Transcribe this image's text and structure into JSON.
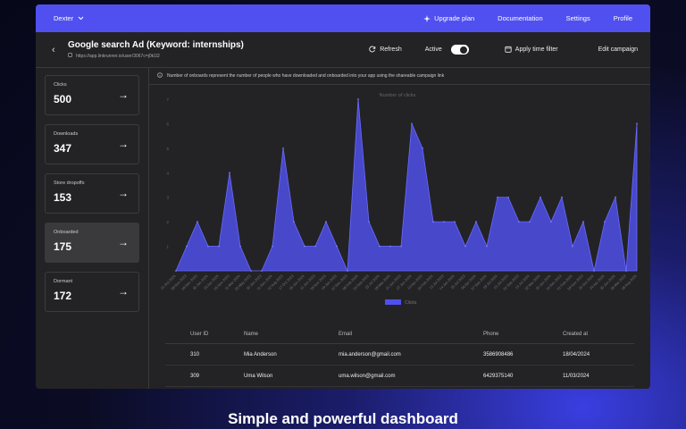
{
  "topbar": {
    "user": "Dexter",
    "nav": [
      {
        "label": "Upgrade plan",
        "icon": "sparkle-icon"
      },
      {
        "label": "Documentation"
      },
      {
        "label": "Settings"
      },
      {
        "label": "Profile"
      }
    ]
  },
  "header": {
    "title": "Google search Ad (Keyword: internships)",
    "url": "https://app.linkrunner.io/user/3067c=j0k1l2",
    "refresh": "Refresh",
    "active": "Active",
    "time_filter": "Apply time filter",
    "edit": "Edit campaign"
  },
  "sidebar": {
    "cards": [
      {
        "label": "Clicks",
        "value": "500"
      },
      {
        "label": "Downloads",
        "value": "347"
      },
      {
        "label": "Store dropoffs",
        "value": "153"
      },
      {
        "label": "Onboarded",
        "value": "175",
        "active": true
      },
      {
        "label": "Dormant",
        "value": "172"
      }
    ]
  },
  "notice": "Number of onboards represent the number of people who have downloaded and onboarded into your app using the shareable campaign link",
  "chart_data": {
    "type": "area",
    "title": "Number of clicks",
    "legend": "Clicks",
    "color": "#5050f0",
    "ylim": [
      0,
      7
    ],
    "yticks": [
      "1",
      "2",
      "3",
      "4",
      "5",
      "6",
      "7"
    ],
    "x": [
      "21 Oct 2024",
      "28 Nov 2023",
      "09 Dec 2023",
      "30 Jan 2024",
      "05 Apr 2024",
      "15 Nov 2023",
      "11 Mar 2024",
      "25 May 2023",
      "30 Jan 2023",
      "11 Dec 2024",
      "12 Aug 2023",
      "17 Oct 2023",
      "05 Jun 2024",
      "11 Jun 2023",
      "29 Nov 2023",
      "19 Jan 2023",
      "07 Dec 2023",
      "06 Feb 2024",
      "23 Sep 2023",
      "22 Jul 2024",
      "09 Mar 2024",
      "21 Jun 2023",
      "27 Jun 2024",
      "14 Apr 2023",
      "24 Feb 2024",
      "12 Jul 2023",
      "14 Jan 2024",
      "20 Jul 2023",
      "06 Apr 2024",
      "27 Sep 2024",
      "18 Jul 2024",
      "01 Jul 2023",
      "01 Sep 2023",
      "13 Jul 2024",
      "22 Mar 2024",
      "20 Jun 2024",
      "14 Dec 2023",
      "01 Feb 2024",
      "09 Nov 2023",
      "20 Oct 2024",
      "24 Apr 2024",
      "30 Jun 2024",
      "26 Mar 2023",
      "18 Aug 2024"
    ],
    "values": [
      0,
      1,
      2,
      1,
      1,
      4,
      1,
      0,
      0,
      1,
      5,
      2,
      1,
      1,
      2,
      1,
      0,
      7,
      2,
      1,
      1,
      1,
      6,
      5,
      2,
      2,
      2,
      1,
      2,
      1,
      3,
      3,
      2,
      2,
      3,
      2,
      3,
      1,
      2,
      0,
      2,
      3,
      0,
      6
    ]
  },
  "table": {
    "headers": [
      "User ID",
      "Name",
      "Email",
      "Phone",
      "Created at"
    ],
    "rows": [
      [
        "310",
        "Mia Anderson",
        "mia.anderson@gmail.com",
        "3586908486",
        "18/04/2024"
      ],
      [
        "309",
        "Uma Wilson",
        "uma.wilson@gmail.com",
        "6429375140",
        "11/03/2024"
      ]
    ]
  },
  "caption": "Simple and powerful dashboard"
}
